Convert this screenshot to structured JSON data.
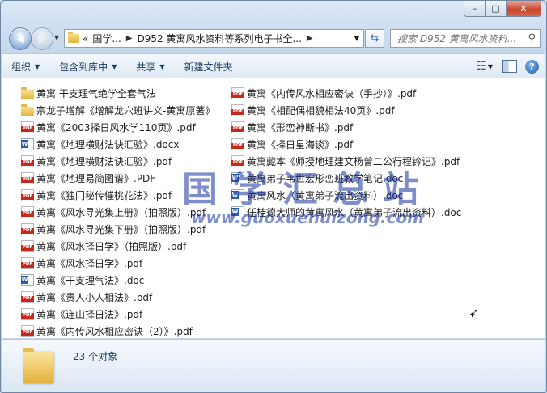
{
  "window": {
    "minimize_glyph": "–",
    "maximize_glyph": "□",
    "close_glyph": "✕"
  },
  "address": {
    "overflow": "«",
    "crumb1": "国学...",
    "crumb2": "D952 黄寓风水资料等系列电子书全..."
  },
  "search": {
    "placeholder": "搜索 D952 黄寓风水资料..."
  },
  "toolbar": {
    "organize": "组织",
    "include_in_library": "包含到库中",
    "share": "共享",
    "new_folder": "新建文件夹"
  },
  "files_col1": [
    {
      "type": "folder",
      "name": "黄寓 干支理气绝学全套气法"
    },
    {
      "type": "folder",
      "name": "宗龙子增解《增解龙穴班讲义-黄寓原著》"
    },
    {
      "type": "pdf",
      "name": "黄寓《2003择日风水学110页》.pdf"
    },
    {
      "type": "doc",
      "name": "黄寓《地理横财法诀汇验》.docx"
    },
    {
      "type": "pdf",
      "name": "黄寓《地理横财法诀汇验》.pdf"
    },
    {
      "type": "pdf",
      "name": "黄寓《地理易简图谱》.PDF"
    },
    {
      "type": "pdf",
      "name": "黄寓《独门秘传催桃花法》.pdf"
    },
    {
      "type": "pdf",
      "name": "黄寓《风水寻光集上册》（拍照版）.pdf"
    },
    {
      "type": "pdf",
      "name": "黄寓《风水寻光集下册》（拍照版）.pdf"
    },
    {
      "type": "pdf",
      "name": "黄寓《风水择日学》（拍照版）.pdf"
    },
    {
      "type": "pdf",
      "name": "黄寓《风水择日学》.pdf"
    },
    {
      "type": "doc",
      "name": "黄寓《干支理气法》.doc"
    },
    {
      "type": "pdf",
      "name": "黄寓《贵人小人相法》.pdf"
    },
    {
      "type": "pdf",
      "name": "黄寓《连山择日法》.pdf"
    },
    {
      "type": "pdf",
      "name": "黄寓《内传风水相应密诀（2）》.pdf"
    }
  ],
  "files_col2": [
    {
      "type": "pdf",
      "name": "黄寓《内传风水相应密诀（手抄）》.pdf"
    },
    {
      "type": "pdf",
      "name": "黄寓《相配偶相貌相法40页》.pdf"
    },
    {
      "type": "pdf",
      "name": "黄寓《形峦神断书》.pdf"
    },
    {
      "type": "pdf",
      "name": "黄寓《择日星海谈》.pdf"
    },
    {
      "type": "pdf",
      "name": "黄寓藏本《师授地理建文杨曾二公行程钤记》.pdf"
    },
    {
      "type": "doc",
      "name": "黄寓弟子韦世宏形峦班教学笔记.doc"
    },
    {
      "type": "doc",
      "name": "黄寓风水（黄寓弟子流出资料）.doc"
    },
    {
      "type": "doc",
      "name": "任桂德大师的黄寓风水（黄寓弟子流出资料）.doc"
    }
  ],
  "watermark": {
    "main": "国学汇总站",
    "url": "www.guoxuehuizong.com"
  },
  "status": {
    "count": "23 个对象"
  }
}
